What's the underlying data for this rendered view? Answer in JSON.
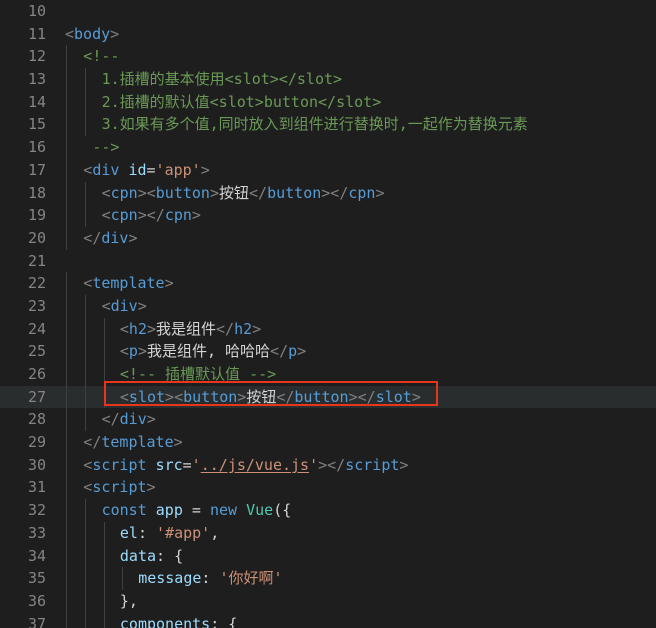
{
  "lines": [
    {
      "num": "10",
      "indent": 0,
      "tokens": []
    },
    {
      "num": "11",
      "indent": 0,
      "tokens": [
        [
          "bracket",
          "<"
        ],
        [
          "tag",
          "body"
        ],
        [
          "bracket",
          ">"
        ]
      ]
    },
    {
      "num": "12",
      "indent": 1,
      "tokens": [
        [
          "comment",
          "<!--"
        ]
      ]
    },
    {
      "num": "13",
      "indent": 2,
      "tokens": [
        [
          "comment",
          "1.插槽的基本使用<slot></slot>"
        ]
      ]
    },
    {
      "num": "14",
      "indent": 2,
      "tokens": [
        [
          "comment",
          "2.插槽的默认值<slot>button</slot>"
        ]
      ]
    },
    {
      "num": "15",
      "indent": 2,
      "tokens": [
        [
          "comment",
          "3.如果有多个值,同时放入到组件进行替换时,一起作为替换元素"
        ]
      ]
    },
    {
      "num": "16",
      "indent": 1,
      "tokens": [
        [
          "comment",
          " -->"
        ]
      ]
    },
    {
      "num": "17",
      "indent": 1,
      "tokens": [
        [
          "bracket",
          "<"
        ],
        [
          "tag",
          "div"
        ],
        [
          "text",
          " "
        ],
        [
          "attr",
          "id"
        ],
        [
          "text",
          "="
        ],
        [
          "str",
          "'app'"
        ],
        [
          "bracket",
          ">"
        ]
      ]
    },
    {
      "num": "18",
      "indent": 2,
      "tokens": [
        [
          "bracket",
          "<"
        ],
        [
          "tag",
          "cpn"
        ],
        [
          "bracket",
          "><"
        ],
        [
          "tag",
          "button"
        ],
        [
          "bracket",
          ">"
        ],
        [
          "text",
          "按钮"
        ],
        [
          "bracket",
          "</"
        ],
        [
          "tag",
          "button"
        ],
        [
          "bracket",
          "></"
        ],
        [
          "tag",
          "cpn"
        ],
        [
          "bracket",
          ">"
        ]
      ]
    },
    {
      "num": "19",
      "indent": 2,
      "tokens": [
        [
          "bracket",
          "<"
        ],
        [
          "tag",
          "cpn"
        ],
        [
          "bracket",
          "></"
        ],
        [
          "tag",
          "cpn"
        ],
        [
          "bracket",
          ">"
        ]
      ]
    },
    {
      "num": "20",
      "indent": 1,
      "tokens": [
        [
          "bracket",
          "</"
        ],
        [
          "tag",
          "div"
        ],
        [
          "bracket",
          ">"
        ]
      ]
    },
    {
      "num": "21",
      "indent": 0,
      "tokens": []
    },
    {
      "num": "22",
      "indent": 1,
      "tokens": [
        [
          "bracket",
          "<"
        ],
        [
          "tag",
          "template"
        ],
        [
          "bracket",
          ">"
        ]
      ]
    },
    {
      "num": "23",
      "indent": 2,
      "tokens": [
        [
          "bracket",
          "<"
        ],
        [
          "tag",
          "div"
        ],
        [
          "bracket",
          ">"
        ]
      ]
    },
    {
      "num": "24",
      "indent": 3,
      "tokens": [
        [
          "bracket",
          "<"
        ],
        [
          "tag",
          "h2"
        ],
        [
          "bracket",
          ">"
        ],
        [
          "text",
          "我是组件"
        ],
        [
          "bracket",
          "</"
        ],
        [
          "tag",
          "h2"
        ],
        [
          "bracket",
          ">"
        ]
      ]
    },
    {
      "num": "25",
      "indent": 3,
      "tokens": [
        [
          "bracket",
          "<"
        ],
        [
          "tag",
          "p"
        ],
        [
          "bracket",
          ">"
        ],
        [
          "text",
          "我是组件, 哈哈哈"
        ],
        [
          "bracket",
          "</"
        ],
        [
          "tag",
          "p"
        ],
        [
          "bracket",
          ">"
        ]
      ]
    },
    {
      "num": "26",
      "indent": 3,
      "tokens": [
        [
          "comment",
          "<!-- 插槽默认值 -->"
        ]
      ]
    },
    {
      "num": "27",
      "indent": 3,
      "tokens": [
        [
          "bracket",
          "<"
        ],
        [
          "tag",
          "slot"
        ],
        [
          "bracket",
          "><"
        ],
        [
          "tag",
          "button"
        ],
        [
          "bracket",
          ">"
        ],
        [
          "text",
          "按钮"
        ],
        [
          "bracket",
          "</"
        ],
        [
          "tag",
          "button"
        ],
        [
          "bracket",
          ">"
        ],
        [
          "bracket",
          "<"
        ],
        [
          "bracket",
          "/"
        ],
        [
          "tag",
          "slot"
        ],
        [
          "bracket",
          ">"
        ]
      ]
    },
    {
      "num": "28",
      "indent": 2,
      "tokens": [
        [
          "bracket",
          "</"
        ],
        [
          "tag",
          "div"
        ],
        [
          "bracket",
          ">"
        ]
      ]
    },
    {
      "num": "29",
      "indent": 1,
      "tokens": [
        [
          "bracket",
          "</"
        ],
        [
          "tag",
          "template"
        ],
        [
          "bracket",
          ">"
        ]
      ]
    },
    {
      "num": "30",
      "indent": 1,
      "tokens": [
        [
          "bracket",
          "<"
        ],
        [
          "tag",
          "script"
        ],
        [
          "text",
          " "
        ],
        [
          "attr",
          "src"
        ],
        [
          "text",
          "="
        ],
        [
          "str",
          "'"
        ],
        [
          "str-u",
          "../js/vue.js"
        ],
        [
          "str",
          "'"
        ],
        [
          "bracket",
          "></"
        ],
        [
          "tag",
          "script"
        ],
        [
          "bracket",
          ">"
        ]
      ]
    },
    {
      "num": "31",
      "indent": 1,
      "tokens": [
        [
          "bracket",
          "<"
        ],
        [
          "tag",
          "script"
        ],
        [
          "bracket",
          ">"
        ]
      ]
    },
    {
      "num": "32",
      "indent": 2,
      "tokens": [
        [
          "kw",
          "const"
        ],
        [
          "text",
          " "
        ],
        [
          "var",
          "app"
        ],
        [
          "text",
          " = "
        ],
        [
          "kw",
          "new"
        ],
        [
          "text",
          " "
        ],
        [
          "cls",
          "Vue"
        ],
        [
          "punc",
          "({"
        ]
      ]
    },
    {
      "num": "33",
      "indent": 3,
      "tokens": [
        [
          "var",
          "el"
        ],
        [
          "punc",
          ": "
        ],
        [
          "str",
          "'#app'"
        ],
        [
          "punc",
          ","
        ]
      ]
    },
    {
      "num": "34",
      "indent": 3,
      "tokens": [
        [
          "var",
          "data"
        ],
        [
          "punc",
          ": {"
        ]
      ]
    },
    {
      "num": "35",
      "indent": 4,
      "tokens": [
        [
          "var",
          "message"
        ],
        [
          "punc",
          ": "
        ],
        [
          "str",
          "'你好啊'"
        ]
      ]
    },
    {
      "num": "36",
      "indent": 3,
      "tokens": [
        [
          "punc",
          "},"
        ]
      ]
    },
    {
      "num": "37",
      "indent": 3,
      "tokens": [
        [
          "var",
          "components"
        ],
        [
          "punc",
          ": {"
        ]
      ]
    }
  ],
  "highlight_line": "27"
}
